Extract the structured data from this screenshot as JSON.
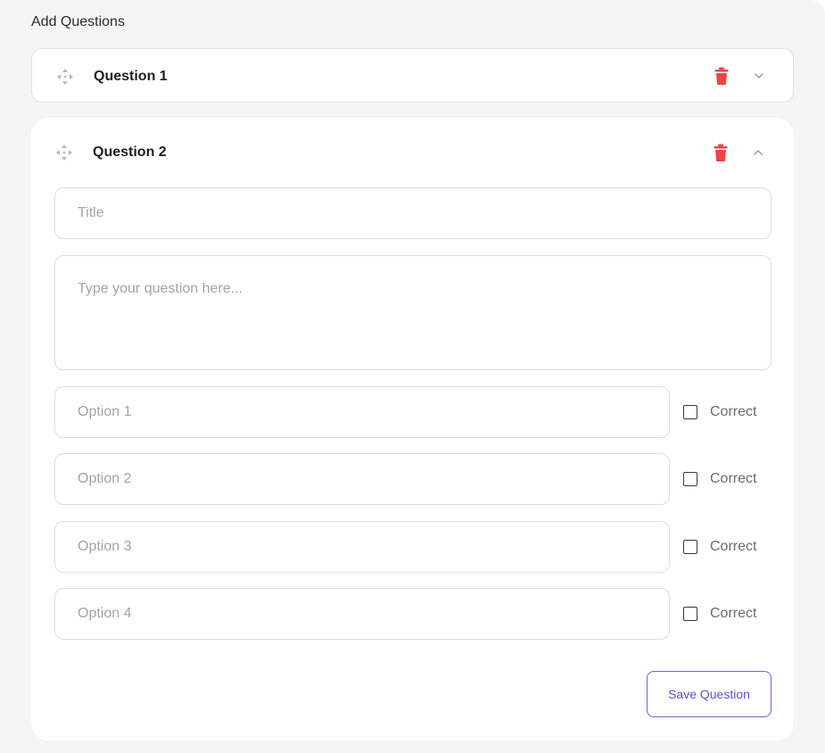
{
  "section_title": "Add Questions",
  "questions": [
    {
      "title": "Question 1",
      "expanded": false
    },
    {
      "title": "Question 2",
      "expanded": true
    }
  ],
  "form": {
    "title_placeholder": "Title",
    "title_value": "",
    "question_placeholder": "Type your question here...",
    "question_value": "",
    "options": [
      {
        "placeholder": "Option 1",
        "value": "",
        "correct_label": "Correct",
        "correct": false
      },
      {
        "placeholder": "Option 2",
        "value": "",
        "correct_label": "Correct",
        "correct": false
      },
      {
        "placeholder": "Option 3",
        "value": "",
        "correct_label": "Correct",
        "correct": false
      },
      {
        "placeholder": "Option 4",
        "value": "",
        "correct_label": "Correct",
        "correct": false
      }
    ],
    "save_label": "Save Question"
  },
  "icons": {
    "drag": "move-arrows-icon",
    "delete": "trash-icon",
    "collapse": "chevron-down-icon",
    "expand": "chevron-up-icon"
  },
  "colors": {
    "background": "#f5f5f5",
    "card": "#ffffff",
    "delete": "#ef4444",
    "accent": "#5b4fd4",
    "border": "#dedede"
  }
}
